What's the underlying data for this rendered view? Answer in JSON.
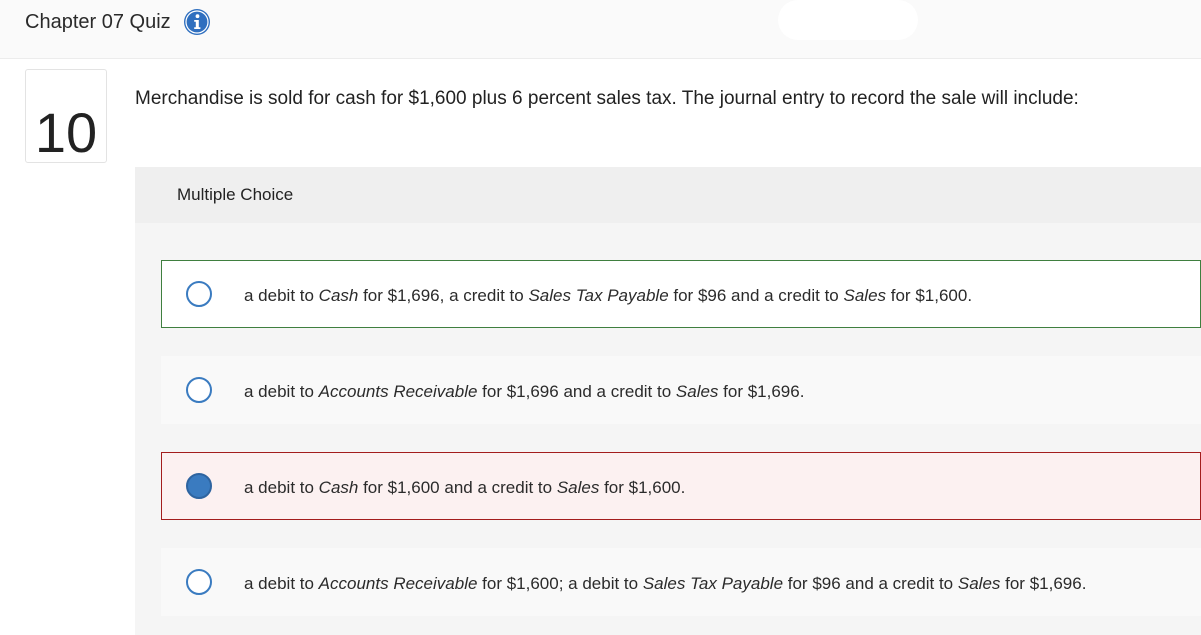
{
  "header": {
    "title": "Chapter 07 Quiz",
    "info_icon": "info-icon"
  },
  "question": {
    "number": "10",
    "prompt": "Merchandise is sold for cash for $1,600 plus 6 percent sales tax. The journal entry to record the sale will include:",
    "type_label": "Multiple Choice"
  },
  "choices": [
    {
      "state": "correct",
      "selected": false,
      "parts": [
        {
          "t": "a debit to "
        },
        {
          "t": "Cash",
          "i": true
        },
        {
          "t": " for $1,696, a credit to "
        },
        {
          "t": "Sales Tax Payable",
          "i": true
        },
        {
          "t": " for $96 and a credit to "
        },
        {
          "t": "Sales",
          "i": true
        },
        {
          "t": " for $1,600."
        }
      ]
    },
    {
      "state": "neutral",
      "selected": false,
      "parts": [
        {
          "t": "a debit to "
        },
        {
          "t": "Accounts Receivable",
          "i": true
        },
        {
          "t": " for $1,696 and a credit to "
        },
        {
          "t": "Sales",
          "i": true
        },
        {
          "t": " for $1,696."
        }
      ]
    },
    {
      "state": "incorrect",
      "selected": true,
      "parts": [
        {
          "t": "a debit to "
        },
        {
          "t": "Cash",
          "i": true
        },
        {
          "t": " for $1,600 and a credit to "
        },
        {
          "t": "Sales",
          "i": true
        },
        {
          "t": " for $1,600."
        }
      ]
    },
    {
      "state": "neutral",
      "selected": false,
      "parts": [
        {
          "t": "a debit to "
        },
        {
          "t": "Accounts Receivable",
          "i": true
        },
        {
          "t": " for $1,600; a debit to "
        },
        {
          "t": "Sales Tax Payable",
          "i": true
        },
        {
          "t": " for $96 and a credit to "
        },
        {
          "t": "Sales",
          "i": true
        },
        {
          "t": " for $1,696."
        }
      ]
    }
  ],
  "colors": {
    "accent": "#3a7bc0",
    "correct_border": "#3f7f3f",
    "incorrect_border": "#a31d1d",
    "incorrect_bg": "#fcf1f1"
  }
}
